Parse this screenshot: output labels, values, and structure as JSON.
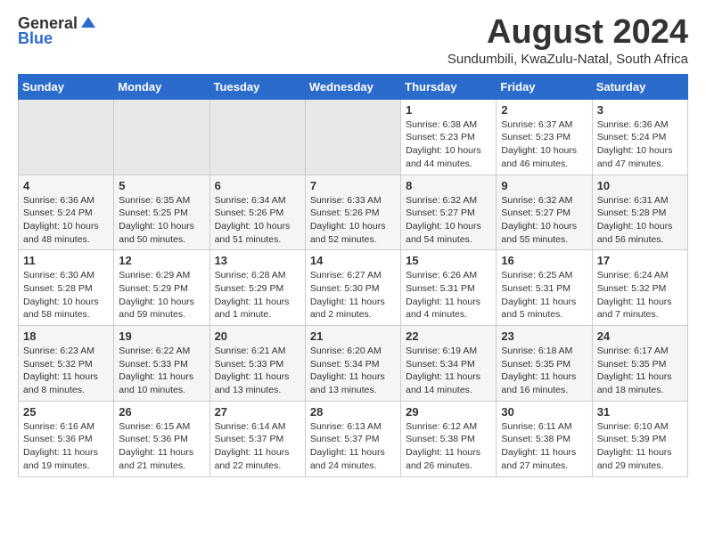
{
  "header": {
    "logo_general": "General",
    "logo_blue": "Blue",
    "month_year": "August 2024",
    "location": "Sundumbili, KwaZulu-Natal, South Africa"
  },
  "weekdays": [
    "Sunday",
    "Monday",
    "Tuesday",
    "Wednesday",
    "Thursday",
    "Friday",
    "Saturday"
  ],
  "weeks": [
    [
      {
        "day": "",
        "content": ""
      },
      {
        "day": "",
        "content": ""
      },
      {
        "day": "",
        "content": ""
      },
      {
        "day": "",
        "content": ""
      },
      {
        "day": "1",
        "content": "Sunrise: 6:38 AM\nSunset: 5:23 PM\nDaylight: 10 hours\nand 44 minutes."
      },
      {
        "day": "2",
        "content": "Sunrise: 6:37 AM\nSunset: 5:23 PM\nDaylight: 10 hours\nand 46 minutes."
      },
      {
        "day": "3",
        "content": "Sunrise: 6:36 AM\nSunset: 5:24 PM\nDaylight: 10 hours\nand 47 minutes."
      }
    ],
    [
      {
        "day": "4",
        "content": "Sunrise: 6:36 AM\nSunset: 5:24 PM\nDaylight: 10 hours\nand 48 minutes."
      },
      {
        "day": "5",
        "content": "Sunrise: 6:35 AM\nSunset: 5:25 PM\nDaylight: 10 hours\nand 50 minutes."
      },
      {
        "day": "6",
        "content": "Sunrise: 6:34 AM\nSunset: 5:26 PM\nDaylight: 10 hours\nand 51 minutes."
      },
      {
        "day": "7",
        "content": "Sunrise: 6:33 AM\nSunset: 5:26 PM\nDaylight: 10 hours\nand 52 minutes."
      },
      {
        "day": "8",
        "content": "Sunrise: 6:32 AM\nSunset: 5:27 PM\nDaylight: 10 hours\nand 54 minutes."
      },
      {
        "day": "9",
        "content": "Sunrise: 6:32 AM\nSunset: 5:27 PM\nDaylight: 10 hours\nand 55 minutes."
      },
      {
        "day": "10",
        "content": "Sunrise: 6:31 AM\nSunset: 5:28 PM\nDaylight: 10 hours\nand 56 minutes."
      }
    ],
    [
      {
        "day": "11",
        "content": "Sunrise: 6:30 AM\nSunset: 5:28 PM\nDaylight: 10 hours\nand 58 minutes."
      },
      {
        "day": "12",
        "content": "Sunrise: 6:29 AM\nSunset: 5:29 PM\nDaylight: 10 hours\nand 59 minutes."
      },
      {
        "day": "13",
        "content": "Sunrise: 6:28 AM\nSunset: 5:29 PM\nDaylight: 11 hours\nand 1 minute."
      },
      {
        "day": "14",
        "content": "Sunrise: 6:27 AM\nSunset: 5:30 PM\nDaylight: 11 hours\nand 2 minutes."
      },
      {
        "day": "15",
        "content": "Sunrise: 6:26 AM\nSunset: 5:31 PM\nDaylight: 11 hours\nand 4 minutes."
      },
      {
        "day": "16",
        "content": "Sunrise: 6:25 AM\nSunset: 5:31 PM\nDaylight: 11 hours\nand 5 minutes."
      },
      {
        "day": "17",
        "content": "Sunrise: 6:24 AM\nSunset: 5:32 PM\nDaylight: 11 hours\nand 7 minutes."
      }
    ],
    [
      {
        "day": "18",
        "content": "Sunrise: 6:23 AM\nSunset: 5:32 PM\nDaylight: 11 hours\nand 8 minutes."
      },
      {
        "day": "19",
        "content": "Sunrise: 6:22 AM\nSunset: 5:33 PM\nDaylight: 11 hours\nand 10 minutes."
      },
      {
        "day": "20",
        "content": "Sunrise: 6:21 AM\nSunset: 5:33 PM\nDaylight: 11 hours\nand 13 minutes."
      },
      {
        "day": "21",
        "content": "Sunrise: 6:20 AM\nSunset: 5:34 PM\nDaylight: 11 hours\nand 13 minutes."
      },
      {
        "day": "22",
        "content": "Sunrise: 6:19 AM\nSunset: 5:34 PM\nDaylight: 11 hours\nand 14 minutes."
      },
      {
        "day": "23",
        "content": "Sunrise: 6:18 AM\nSunset: 5:35 PM\nDaylight: 11 hours\nand 16 minutes."
      },
      {
        "day": "24",
        "content": "Sunrise: 6:17 AM\nSunset: 5:35 PM\nDaylight: 11 hours\nand 18 minutes."
      }
    ],
    [
      {
        "day": "25",
        "content": "Sunrise: 6:16 AM\nSunset: 5:36 PM\nDaylight: 11 hours\nand 19 minutes."
      },
      {
        "day": "26",
        "content": "Sunrise: 6:15 AM\nSunset: 5:36 PM\nDaylight: 11 hours\nand 21 minutes."
      },
      {
        "day": "27",
        "content": "Sunrise: 6:14 AM\nSunset: 5:37 PM\nDaylight: 11 hours\nand 22 minutes."
      },
      {
        "day": "28",
        "content": "Sunrise: 6:13 AM\nSunset: 5:37 PM\nDaylight: 11 hours\nand 24 minutes."
      },
      {
        "day": "29",
        "content": "Sunrise: 6:12 AM\nSunset: 5:38 PM\nDaylight: 11 hours\nand 26 minutes."
      },
      {
        "day": "30",
        "content": "Sunrise: 6:11 AM\nSunset: 5:38 PM\nDaylight: 11 hours\nand 27 minutes."
      },
      {
        "day": "31",
        "content": "Sunrise: 6:10 AM\nSunset: 5:39 PM\nDaylight: 11 hours\nand 29 minutes."
      }
    ]
  ]
}
